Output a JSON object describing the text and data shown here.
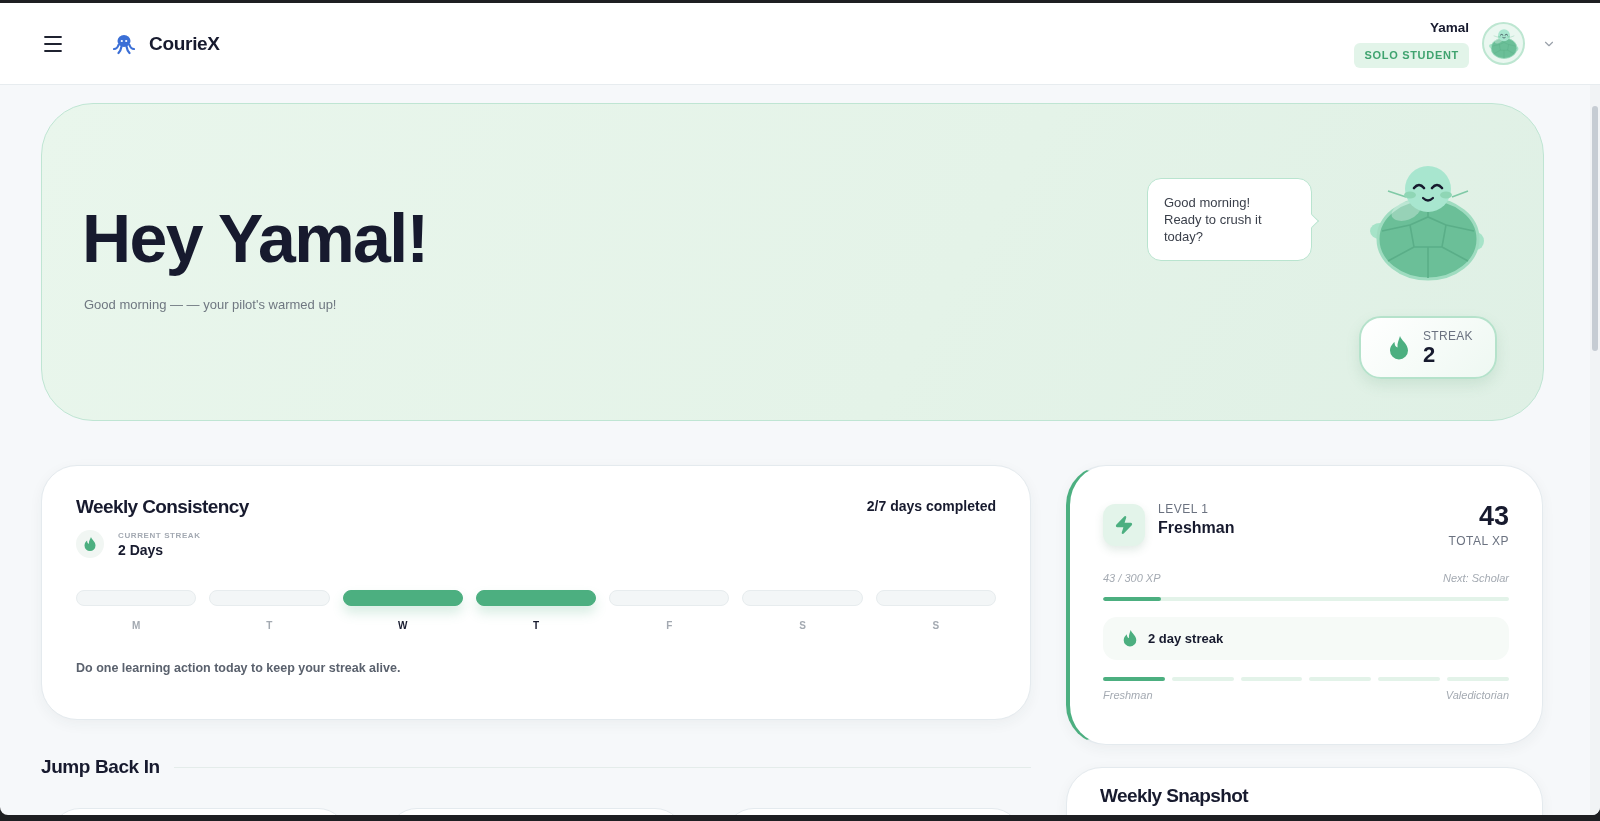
{
  "header": {
    "app_name": "CourieX",
    "user_name": "Yamal",
    "user_badge": "SOLO STUDENT"
  },
  "hero": {
    "title": "Hey Yamal!",
    "subtitle": "Good morning — — your pilot's warmed up!",
    "speech": "Good morning! Ready to crush it today?",
    "streak": {
      "label": "STREAK",
      "value": "2"
    }
  },
  "weekly_consistency": {
    "title": "Weekly Consistency",
    "summary": "2/7 days completed",
    "current_streak": {
      "label": "CURRENT STREAK",
      "value": "2 Days"
    },
    "days": [
      {
        "label": "M",
        "completed": false
      },
      {
        "label": "T",
        "completed": false
      },
      {
        "label": "W",
        "completed": true
      },
      {
        "label": "T",
        "completed": true
      },
      {
        "label": "F",
        "completed": false
      },
      {
        "label": "S",
        "completed": false
      },
      {
        "label": "S",
        "completed": false
      }
    ],
    "hint": "Do one learning action today to keep your streak alive."
  },
  "level_card": {
    "level_label": "LEVEL 1",
    "rank": "Freshman",
    "total_xp": "43",
    "total_xp_label": "TOTAL XP",
    "xp_text": "43 / 300 XP",
    "next_text": "Next: Scholar",
    "xp_progress": {
      "level": 0.143
    },
    "streak_text": "2 day streak",
    "rank_track": {
      "segments": [
        {
          "reached": true
        },
        {
          "reached": false
        },
        {
          "reached": false
        },
        {
          "reached": false
        },
        {
          "reached": false
        },
        {
          "reached": false
        }
      ],
      "start_label": "Freshman",
      "end_label": "Valedictorian"
    }
  },
  "jump_back_in": {
    "title": "Jump Back In"
  },
  "weekly_snapshot": {
    "title": "Weekly Snapshot"
  }
}
